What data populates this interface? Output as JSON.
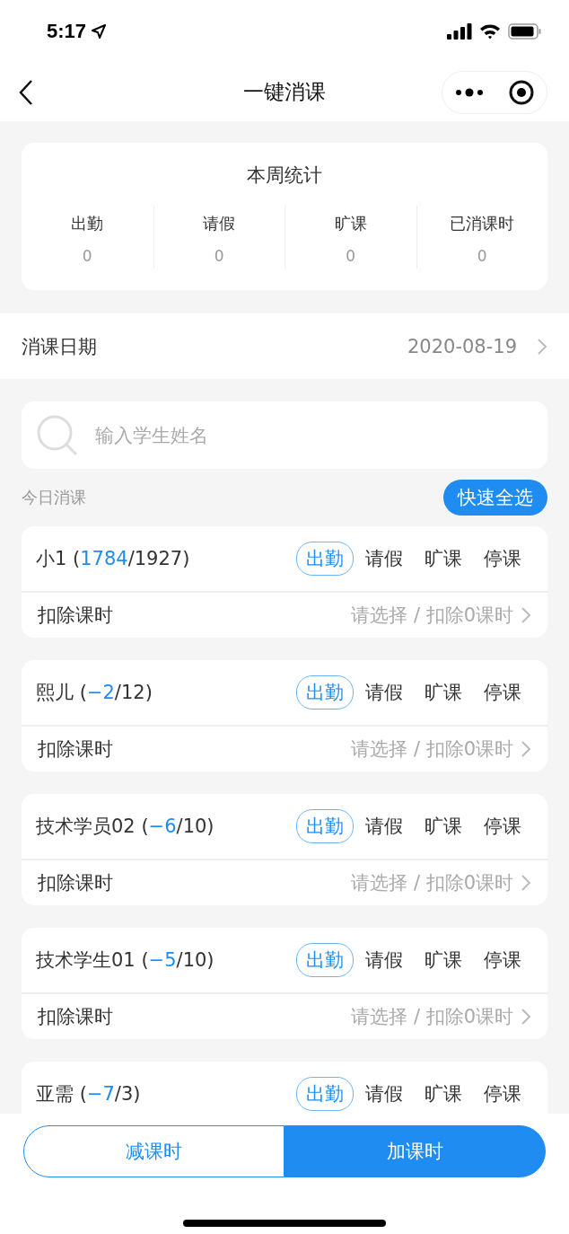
{
  "status_bar": {
    "time": "5:17"
  },
  "nav": {
    "title": "一键消课"
  },
  "weekly_stats": {
    "title": "本周统计",
    "items": [
      {
        "label": "出勤",
        "value": "0"
      },
      {
        "label": "请假",
        "value": "0"
      },
      {
        "label": "旷课",
        "value": "0"
      },
      {
        "label": "已消课时",
        "value": "0"
      }
    ]
  },
  "date_row": {
    "label": "消课日期",
    "value": "2020-08-19"
  },
  "search": {
    "placeholder": "输入学生姓名"
  },
  "section": {
    "title": "今日消课",
    "select_all": "快速全选"
  },
  "students": [
    {
      "before": "小1 (",
      "count": "1784",
      "after": "/1927)",
      "statuses": [
        {
          "label": "出勤",
          "selected": true
        },
        {
          "label": "请假",
          "selected": false
        },
        {
          "label": "旷课",
          "selected": false
        },
        {
          "label": "停课",
          "selected": false
        }
      ],
      "deduct_label": "扣除课时",
      "deduct_value": "请选择 / 扣除0课时"
    },
    {
      "before": "熙儿 (",
      "count": "−2",
      "after": "/12)",
      "statuses": [
        {
          "label": "出勤",
          "selected": true
        },
        {
          "label": "请假",
          "selected": false
        },
        {
          "label": "旷课",
          "selected": false
        },
        {
          "label": "停课",
          "selected": false
        }
      ],
      "deduct_label": "扣除课时",
      "deduct_value": "请选择 / 扣除0课时"
    },
    {
      "before": "技术学员02 (",
      "count": "−6",
      "after": "/10)",
      "statuses": [
        {
          "label": "出勤",
          "selected": true
        },
        {
          "label": "请假",
          "selected": false
        },
        {
          "label": "旷课",
          "selected": false
        },
        {
          "label": "停课",
          "selected": false
        }
      ],
      "deduct_label": "扣除课时",
      "deduct_value": "请选择 / 扣除0课时"
    },
    {
      "before": "技术学生01 (",
      "count": "−5",
      "after": "/10)",
      "statuses": [
        {
          "label": "出勤",
          "selected": true
        },
        {
          "label": "请假",
          "selected": false
        },
        {
          "label": "旷课",
          "selected": false
        },
        {
          "label": "停课",
          "selected": false
        }
      ],
      "deduct_label": "扣除课时",
      "deduct_value": "请选择 / 扣除0课时"
    },
    {
      "before": "亚需 (",
      "count": "−7",
      "after": "/3)",
      "statuses": [
        {
          "label": "出勤",
          "selected": true
        },
        {
          "label": "请假",
          "selected": false
        },
        {
          "label": "旷课",
          "selected": false
        },
        {
          "label": "停课",
          "selected": false
        }
      ]
    }
  ],
  "footer": {
    "buttons": [
      {
        "label": "减课时",
        "selected": false
      },
      {
        "label": "加课时",
        "selected": true
      }
    ]
  }
}
